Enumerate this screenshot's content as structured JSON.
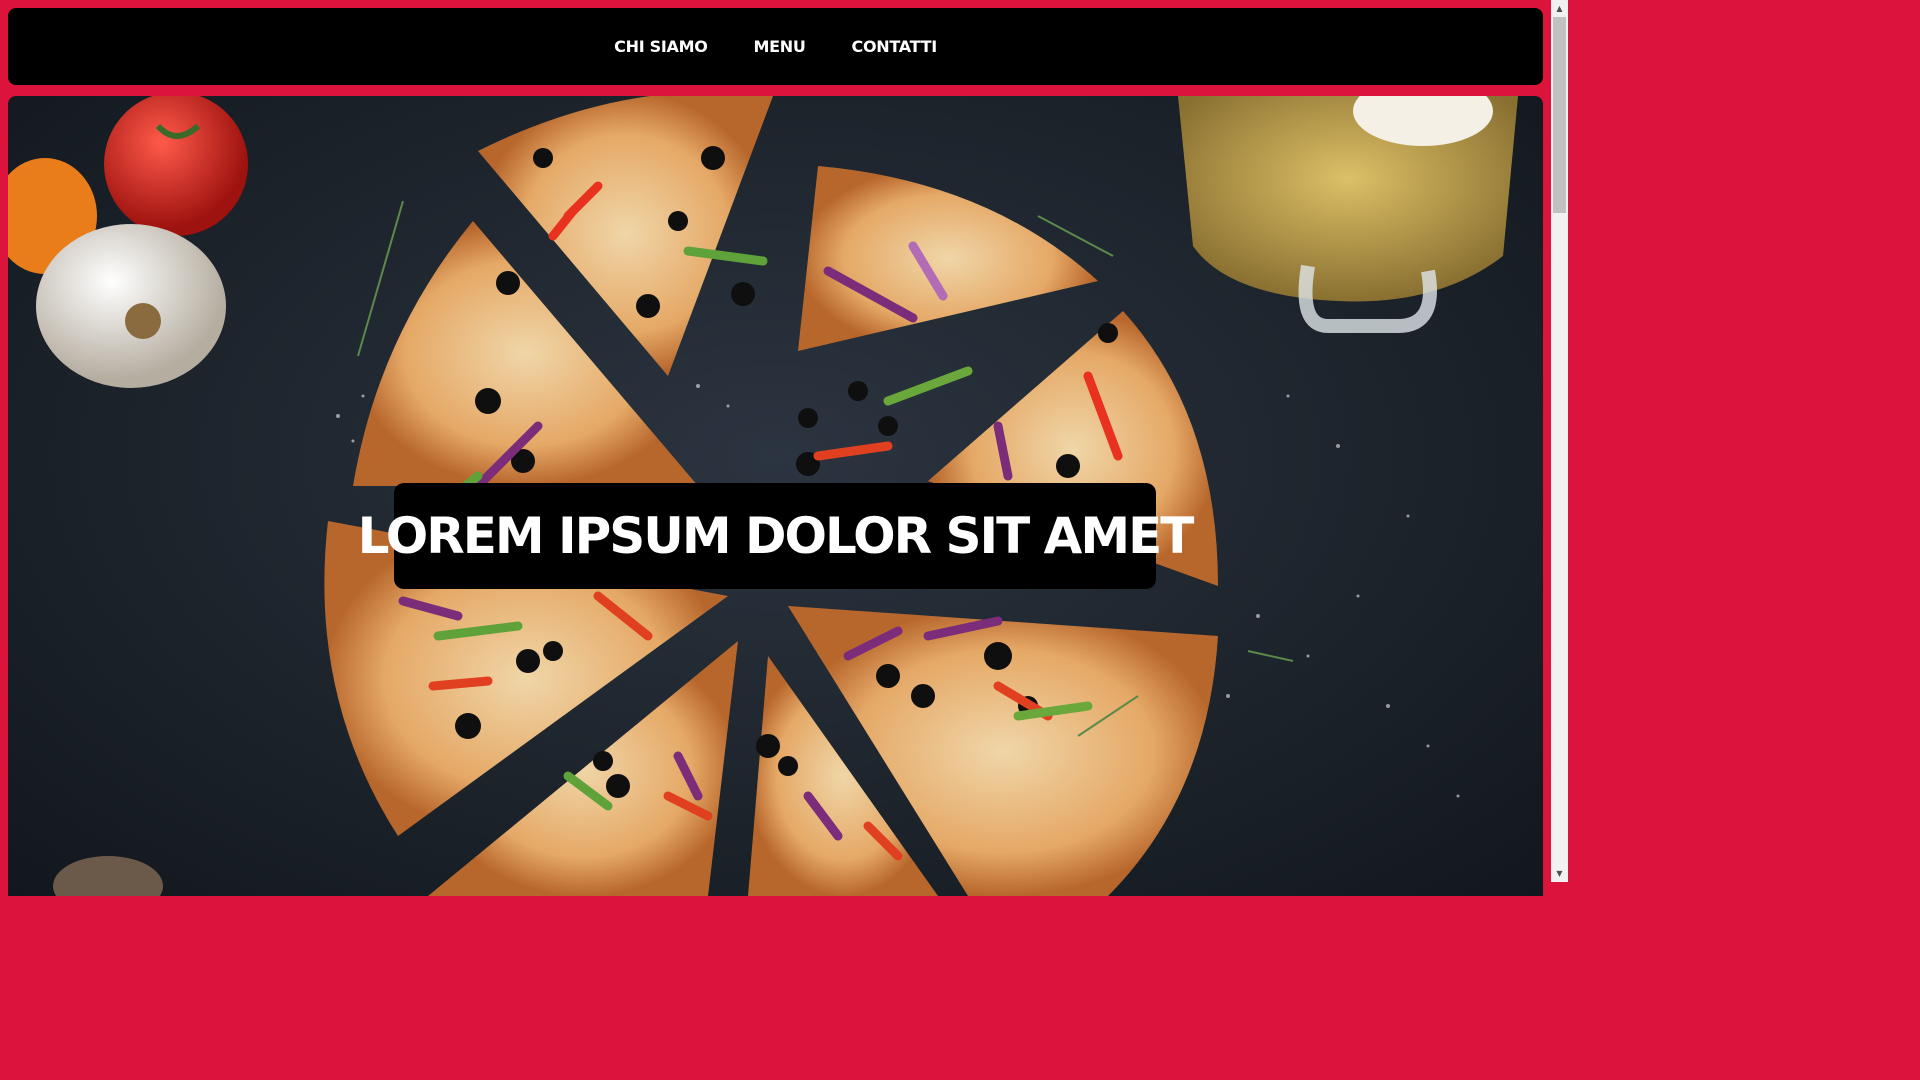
{
  "nav": {
    "items": [
      {
        "label": "CHI SIAMO"
      },
      {
        "label": "MENU"
      },
      {
        "label": "CONTATTI"
      }
    ]
  },
  "hero": {
    "title": "LOREM IPSUM DOLOR SIT AMET"
  },
  "colors": {
    "accent": "#dc143c",
    "navbar": "#000000",
    "hero_background": "#1d242c"
  },
  "icons": {
    "scroll_up": "scroll-up-icon",
    "scroll_down": "scroll-down-icon"
  }
}
